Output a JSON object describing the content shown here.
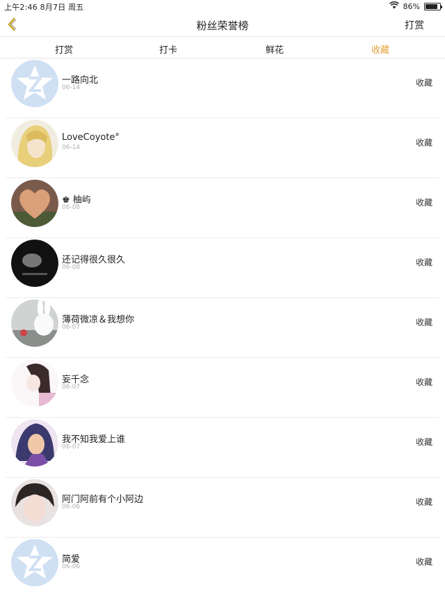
{
  "status_bar": {
    "time_date": "上午2:46  8月7日 周五",
    "battery_percent": "86%",
    "battery_level": 0.86
  },
  "nav": {
    "title": "粉丝荣誉榜",
    "right_action": "打赏"
  },
  "tabs": [
    {
      "label": "打赏",
      "active": false
    },
    {
      "label": "打卡",
      "active": false
    },
    {
      "label": "鲜花",
      "active": false
    },
    {
      "label": "收藏",
      "active": true
    }
  ],
  "colors": {
    "accent": "#e6a23c",
    "divider": "#ececec",
    "date": "#b0b0b0"
  },
  "fans": [
    {
      "name": "一路向北",
      "date": "06-14",
      "action": "收藏",
      "avatar": "default-z-avatar"
    },
    {
      "name": "LoveCoyote°",
      "date": "06-14",
      "action": "收藏",
      "avatar": "anime-blonde-avatar"
    },
    {
      "name": "♚ 柚屿",
      "date": "06-08",
      "action": "收藏",
      "avatar": "heart-photo-avatar"
    },
    {
      "name": "还记得很久很久",
      "date": "06-08",
      "action": "收藏",
      "avatar": "dark-photo-avatar"
    },
    {
      "name": "薄荷微凉＆我想你",
      "date": "06-07",
      "action": "收藏",
      "avatar": "bunny-avatar"
    },
    {
      "name": "妄千念",
      "date": "06-07",
      "action": "收藏",
      "avatar": "anime-girl-sketch-avatar"
    },
    {
      "name": "我不知我爱上谁",
      "date": "06-07",
      "action": "收藏",
      "avatar": "anime-boy-avatar"
    },
    {
      "name": "阿门阿前有个小阿边",
      "date": "06-06",
      "action": "收藏",
      "avatar": "boy-photo-avatar"
    },
    {
      "name": "简爱",
      "date": "06-06",
      "action": "收藏",
      "avatar": "default-z-avatar"
    }
  ]
}
